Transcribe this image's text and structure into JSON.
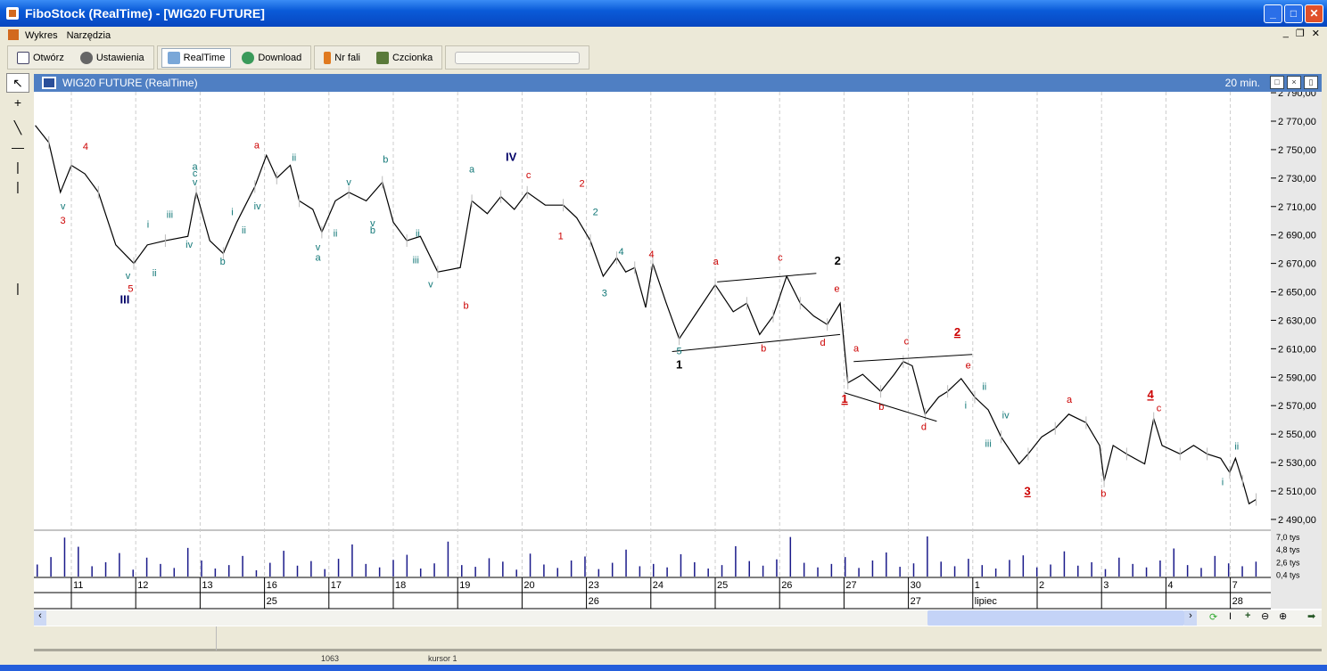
{
  "window": {
    "title": "FiboStock (RealTime) - [WIG20 FUTURE]"
  },
  "menu": [
    "Wykres",
    "Narzędzia"
  ],
  "toolbar": {
    "open": "Otwórz",
    "settings": "Ustawienia",
    "realtime": "RealTime",
    "download": "Download",
    "wave_no": "Nr fali",
    "font": "Czcionka"
  },
  "chart_window": {
    "title": "WIG20 FUTURE (RealTime)",
    "interval": "20 min."
  },
  "status": {
    "value": "1063",
    "cursor": "kursor 1"
  },
  "colors": {
    "red": "#cc0000",
    "teal": "#117777",
    "navy": "#000066",
    "black": "#000000"
  },
  "chart_data": {
    "type": "line",
    "title": "WIG20 FUTURE (RealTime)",
    "x_unit": "trading-day offset from 11",
    "ylim": [
      2480,
      2800
    ],
    "y_ticks": [
      "2 790,00",
      "2 770,00",
      "2 750,00",
      "2 730,00",
      "2 710,00",
      "2 690,00",
      "2 670,00",
      "2 650,00",
      "2 630,00",
      "2 610,00",
      "2 590,00",
      "2 570,00",
      "2 550,00",
      "2 530,00",
      "2 510,00",
      "2 490,00"
    ],
    "y_tick_values": [
      2790,
      2770,
      2750,
      2730,
      2710,
      2690,
      2670,
      2650,
      2630,
      2610,
      2590,
      2570,
      2550,
      2530,
      2510,
      2490
    ],
    "volume_ticks": [
      "7,0 tys",
      "4,8 tys",
      "2,6 tys",
      "0,4 tys"
    ],
    "day_labels": [
      "11",
      "12",
      "13",
      "16",
      "17",
      "18",
      "19",
      "20",
      "23",
      "24",
      "25",
      "26",
      "27",
      "30",
      "1",
      "2",
      "3",
      "4",
      "7"
    ],
    "week_labels": [
      {
        "day": 3,
        "text": "25"
      },
      {
        "day": 8,
        "text": "26"
      },
      {
        "day": 13,
        "text": "27"
      },
      {
        "day": 14,
        "text": "lipiec"
      },
      {
        "day": 18,
        "text": "28"
      }
    ],
    "price": [
      [
        -0.56,
        2767
      ],
      [
        -0.35,
        2755
      ],
      [
        -0.17,
        2720
      ],
      [
        0,
        2739
      ],
      [
        0.21,
        2733
      ],
      [
        0.42,
        2720
      ],
      [
        0.69,
        2683
      ],
      [
        0.97,
        2670
      ],
      [
        1.18,
        2683
      ],
      [
        1.46,
        2686
      ],
      [
        1.81,
        2689
      ],
      [
        1.94,
        2720
      ],
      [
        2.15,
        2686
      ],
      [
        2.36,
        2677
      ],
      [
        2.57,
        2699
      ],
      [
        2.85,
        2724
      ],
      [
        3.03,
        2746
      ],
      [
        3.19,
        2730
      ],
      [
        3.4,
        2739
      ],
      [
        3.54,
        2714
      ],
      [
        3.75,
        2708
      ],
      [
        3.89,
        2692
      ],
      [
        4.1,
        2714
      ],
      [
        4.31,
        2720
      ],
      [
        4.58,
        2714
      ],
      [
        4.83,
        2727
      ],
      [
        5.0,
        2699
      ],
      [
        5.21,
        2686
      ],
      [
        5.42,
        2689
      ],
      [
        5.69,
        2664
      ],
      [
        6.04,
        2667
      ],
      [
        6.22,
        2714
      ],
      [
        6.46,
        2705
      ],
      [
        6.67,
        2717
      ],
      [
        6.88,
        2708
      ],
      [
        7.08,
        2720
      ],
      [
        7.36,
        2711
      ],
      [
        7.64,
        2711
      ],
      [
        7.85,
        2702
      ],
      [
        8.06,
        2686
      ],
      [
        8.26,
        2661
      ],
      [
        8.47,
        2674
      ],
      [
        8.61,
        2664
      ],
      [
        8.75,
        2667
      ],
      [
        8.92,
        2639
      ],
      [
        9.03,
        2670
      ],
      [
        9.24,
        2642
      ],
      [
        9.44,
        2617
      ],
      [
        9.72,
        2636
      ],
      [
        10.0,
        2655
      ],
      [
        10.28,
        2636
      ],
      [
        10.49,
        2642
      ],
      [
        10.69,
        2620
      ],
      [
        10.9,
        2633
      ],
      [
        11.11,
        2661
      ],
      [
        11.32,
        2642
      ],
      [
        11.53,
        2633
      ],
      [
        11.74,
        2627
      ],
      [
        11.94,
        2642
      ],
      [
        12.06,
        2586
      ],
      [
        12.29,
        2592
      ],
      [
        12.57,
        2580
      ],
      [
        12.78,
        2592
      ],
      [
        12.92,
        2601
      ],
      [
        13.06,
        2598
      ],
      [
        13.26,
        2564
      ],
      [
        13.47,
        2576
      ],
      [
        13.61,
        2580
      ],
      [
        13.82,
        2589
      ],
      [
        14.03,
        2576
      ],
      [
        14.24,
        2567
      ],
      [
        14.44,
        2548
      ],
      [
        14.72,
        2529
      ],
      [
        14.86,
        2536
      ],
      [
        15.07,
        2548
      ],
      [
        15.28,
        2554
      ],
      [
        15.49,
        2564
      ],
      [
        15.76,
        2558
      ],
      [
        15.97,
        2542
      ],
      [
        16.04,
        2517
      ],
      [
        16.18,
        2542
      ],
      [
        16.39,
        2536
      ],
      [
        16.67,
        2529
      ],
      [
        16.81,
        2561
      ],
      [
        16.94,
        2542
      ],
      [
        17.22,
        2536
      ],
      [
        17.43,
        2542
      ],
      [
        17.64,
        2536
      ],
      [
        17.85,
        2533
      ],
      [
        17.99,
        2523
      ],
      [
        18.08,
        2533
      ],
      [
        18.19,
        2517
      ],
      [
        18.29,
        2501
      ],
      [
        18.4,
        2504
      ]
    ],
    "volume": [
      2.1,
      3.4,
      6.8,
      5.2,
      1.8,
      2.5,
      4.1,
      1.2,
      3.3,
      2.2,
      1.5,
      5.0,
      2.8,
      1.4,
      2.0,
      3.6,
      1.1,
      2.4,
      4.5,
      1.9,
      2.7,
      1.3,
      3.1,
      5.6,
      2.2,
      1.6,
      2.9,
      3.8,
      1.4,
      2.3,
      6.1,
      2.0,
      1.7,
      3.2,
      2.6,
      1.2,
      4.0,
      2.1,
      1.5,
      2.8,
      3.5,
      1.3,
      2.4,
      4.7,
      1.8,
      2.2,
      1.6,
      3.9,
      2.5,
      1.4,
      2.0,
      5.3,
      2.7,
      1.9,
      3.0,
      6.9,
      2.4,
      1.6,
      2.2,
      3.4,
      1.5,
      2.8,
      4.2,
      1.7,
      2.3,
      7.0,
      2.6,
      1.8,
      3.1,
      2.0,
      1.4,
      2.9,
      3.7,
      1.6,
      2.1,
      4.4,
      1.9,
      2.5,
      1.3,
      3.3,
      2.2,
      1.6,
      2.8,
      4.9,
      2.0,
      1.5,
      3.6,
      2.3,
      1.8,
      2.6
    ],
    "trend_lines": [
      [
        [
          9.33,
          2608
        ],
        [
          11.94,
          2620
        ]
      ],
      [
        [
          10.03,
          2657
        ],
        [
          11.57,
          2663
        ]
      ],
      [
        [
          12.01,
          2579
        ],
        [
          13.44,
          2559
        ]
      ],
      [
        [
          12.15,
          2601
        ],
        [
          13.99,
          2606
        ]
      ]
    ],
    "wave_labels": [
      {
        "t": 0.22,
        "p": 2750,
        "text": "4",
        "c": "red"
      },
      {
        "t": -0.13,
        "p": 2708,
        "text": "v",
        "c": "teal"
      },
      {
        "t": -0.13,
        "p": 2698,
        "text": "3",
        "c": "red"
      },
      {
        "t": 0.88,
        "p": 2659,
        "text": "v",
        "c": "teal"
      },
      {
        "t": 0.92,
        "p": 2650,
        "text": "5",
        "c": "red"
      },
      {
        "t": 0.83,
        "p": 2642,
        "text": "III",
        "c": "navy",
        "b": 1
      },
      {
        "t": 1.92,
        "p": 2736,
        "text": "a",
        "c": "teal"
      },
      {
        "t": 1.92,
        "p": 2731,
        "text": "c",
        "c": "teal"
      },
      {
        "t": 1.92,
        "p": 2725,
        "text": "v",
        "c": "teal"
      },
      {
        "t": 2.88,
        "p": 2751,
        "text": "a",
        "c": "red"
      },
      {
        "t": 2.35,
        "p": 2669,
        "text": "b",
        "c": "teal"
      },
      {
        "t": 1.83,
        "p": 2681,
        "text": "iv",
        "c": "teal"
      },
      {
        "t": 1.29,
        "p": 2661,
        "text": "ii",
        "c": "teal"
      },
      {
        "t": 1.53,
        "p": 2702,
        "text": "iii",
        "c": "teal"
      },
      {
        "t": 1.19,
        "p": 2695,
        "text": "i",
        "c": "teal"
      },
      {
        "t": 2.5,
        "p": 2704,
        "text": "i",
        "c": "teal"
      },
      {
        "t": 2.68,
        "p": 2691,
        "text": "ii",
        "c": "teal"
      },
      {
        "t": 2.89,
        "p": 2708,
        "text": "iv",
        "c": "teal"
      },
      {
        "t": 3.46,
        "p": 2742,
        "text": "ii",
        "c": "teal"
      },
      {
        "t": 3.83,
        "p": 2672,
        "text": "a",
        "c": "teal"
      },
      {
        "t": 3.83,
        "p": 2679,
        "text": "v",
        "c": "teal"
      },
      {
        "t": 4.1,
        "p": 2689,
        "text": "ii",
        "c": "teal"
      },
      {
        "t": 4.31,
        "p": 2725,
        "text": "v",
        "c": "teal"
      },
      {
        "t": 4.68,
        "p": 2691,
        "text": "b",
        "c": "teal"
      },
      {
        "t": 4.68,
        "p": 2696,
        "text": "v",
        "c": "teal"
      },
      {
        "t": 4.88,
        "p": 2741,
        "text": "b",
        "c": "teal"
      },
      {
        "t": 5.38,
        "p": 2689,
        "text": "ii",
        "c": "teal"
      },
      {
        "t": 5.35,
        "p": 2670,
        "text": "iii",
        "c": "teal"
      },
      {
        "t": 5.58,
        "p": 2653,
        "text": "v",
        "c": "teal"
      },
      {
        "t": 6.13,
        "p": 2638,
        "text": "b",
        "c": "red"
      },
      {
        "t": 6.22,
        "p": 2734,
        "text": "a",
        "c": "teal"
      },
      {
        "t": 6.83,
        "p": 2742,
        "text": "IV",
        "c": "navy",
        "b": 1
      },
      {
        "t": 7.1,
        "p": 2730,
        "text": "c",
        "c": "red"
      },
      {
        "t": 7.93,
        "p": 2724,
        "text": "2",
        "c": "red"
      },
      {
        "t": 7.6,
        "p": 2687,
        "text": "1",
        "c": "red"
      },
      {
        "t": 8.14,
        "p": 2704,
        "text": "2",
        "c": "teal"
      },
      {
        "t": 8.54,
        "p": 2676,
        "text": "4",
        "c": "teal"
      },
      {
        "t": 8.28,
        "p": 2647,
        "text": "3",
        "c": "teal"
      },
      {
        "t": 9.01,
        "p": 2674,
        "text": "4",
        "c": "red"
      },
      {
        "t": 9.44,
        "p": 2606,
        "text": "5",
        "c": "teal"
      },
      {
        "t": 9.44,
        "p": 2596,
        "text": "1",
        "c": "black",
        "b": 1
      },
      {
        "t": 10.01,
        "p": 2669,
        "text": "a",
        "c": "red"
      },
      {
        "t": 11.01,
        "p": 2672,
        "text": "c",
        "c": "red"
      },
      {
        "t": 11.9,
        "p": 2669,
        "text": "2",
        "c": "black",
        "b": 1
      },
      {
        "t": 11.89,
        "p": 2650,
        "text": "e",
        "c": "red"
      },
      {
        "t": 10.75,
        "p": 2608,
        "text": "b",
        "c": "red"
      },
      {
        "t": 11.67,
        "p": 2612,
        "text": "d",
        "c": "red"
      },
      {
        "t": 12.19,
        "p": 2608,
        "text": "a",
        "c": "red"
      },
      {
        "t": 12.01,
        "p": 2572,
        "text": "1",
        "c": "red",
        "b": 1,
        "u": 1
      },
      {
        "t": 12.97,
        "p": 2613,
        "text": "c",
        "c": "red"
      },
      {
        "t": 12.58,
        "p": 2567,
        "text": "b",
        "c": "red"
      },
      {
        "t": 13.76,
        "p": 2619,
        "text": "2",
        "c": "red",
        "b": 1,
        "u": 1
      },
      {
        "t": 13.93,
        "p": 2596,
        "text": "e",
        "c": "red"
      },
      {
        "t": 13.24,
        "p": 2553,
        "text": "d",
        "c": "red"
      },
      {
        "t": 13.89,
        "p": 2568,
        "text": "i",
        "c": "teal"
      },
      {
        "t": 14.18,
        "p": 2581,
        "text": "ii",
        "c": "teal"
      },
      {
        "t": 14.51,
        "p": 2561,
        "text": "iv",
        "c": "teal"
      },
      {
        "t": 14.24,
        "p": 2541,
        "text": "iii",
        "c": "teal"
      },
      {
        "t": 14.85,
        "p": 2507,
        "text": "3",
        "c": "red",
        "b": 1,
        "u": 1
      },
      {
        "t": 15.5,
        "p": 2572,
        "text": "a",
        "c": "red"
      },
      {
        "t": 16.03,
        "p": 2506,
        "text": "b",
        "c": "red"
      },
      {
        "t": 16.76,
        "p": 2575,
        "text": "4",
        "c": "red",
        "b": 1,
        "u": 1
      },
      {
        "t": 16.89,
        "p": 2566,
        "text": "c",
        "c": "red"
      },
      {
        "t": 17.88,
        "p": 2514,
        "text": "i",
        "c": "teal"
      },
      {
        "t": 18.1,
        "p": 2539,
        "text": "ii",
        "c": "teal"
      }
    ]
  }
}
